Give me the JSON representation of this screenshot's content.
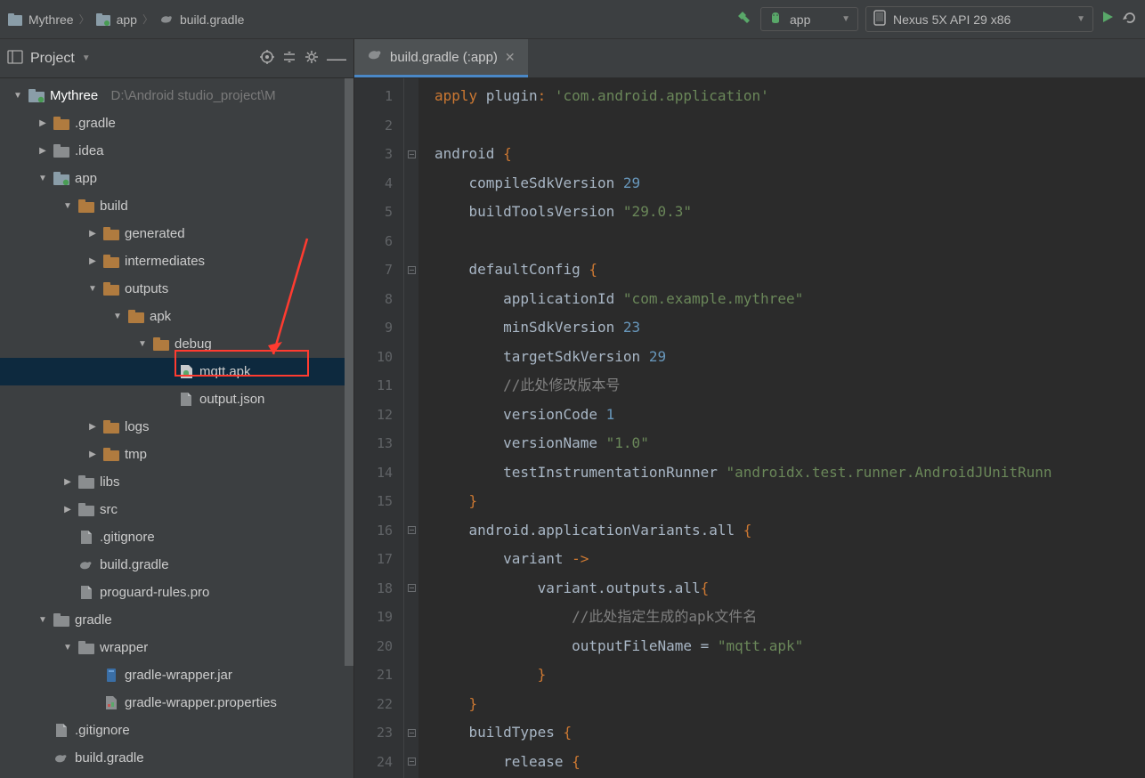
{
  "breadcrumb": {
    "items": [
      "Mythree",
      "app",
      "build.gradle"
    ]
  },
  "toolbar": {
    "run_config": "app",
    "device": "Nexus 5X API 29 x86"
  },
  "project_panel": {
    "title": "Project"
  },
  "tab": {
    "label": "build.gradle (:app)"
  },
  "tree": {
    "root": "Mythree",
    "root_path": "D:\\Android studio_project\\M",
    "nodes": [
      {
        "d": 0,
        "a": "down",
        "i": "module",
        "n": "Mythree",
        "extra": "D:\\Android studio_project\\M"
      },
      {
        "d": 1,
        "a": "right",
        "i": "folder",
        "n": ".gradle"
      },
      {
        "d": 1,
        "a": "right",
        "i": "folder-grey",
        "n": ".idea"
      },
      {
        "d": 1,
        "a": "down",
        "i": "module",
        "n": "app"
      },
      {
        "d": 2,
        "a": "down",
        "i": "folder",
        "n": "build"
      },
      {
        "d": 3,
        "a": "right",
        "i": "folder",
        "n": "generated"
      },
      {
        "d": 3,
        "a": "right",
        "i": "folder",
        "n": "intermediates"
      },
      {
        "d": 3,
        "a": "down",
        "i": "folder",
        "n": "outputs"
      },
      {
        "d": 4,
        "a": "down",
        "i": "folder",
        "n": "apk"
      },
      {
        "d": 5,
        "a": "down",
        "i": "folder",
        "n": "debug"
      },
      {
        "d": 6,
        "a": "",
        "i": "apk",
        "n": "mqtt.apk",
        "sel": true
      },
      {
        "d": 6,
        "a": "",
        "i": "file",
        "n": "output.json"
      },
      {
        "d": 3,
        "a": "right",
        "i": "folder",
        "n": "logs"
      },
      {
        "d": 3,
        "a": "right",
        "i": "folder",
        "n": "tmp"
      },
      {
        "d": 2,
        "a": "right",
        "i": "folder-grey",
        "n": "libs"
      },
      {
        "d": 2,
        "a": "right",
        "i": "folder-grey",
        "n": "src"
      },
      {
        "d": 2,
        "a": "",
        "i": "file",
        "n": ".gitignore"
      },
      {
        "d": 2,
        "a": "",
        "i": "gradle",
        "n": "build.gradle"
      },
      {
        "d": 2,
        "a": "",
        "i": "file",
        "n": "proguard-rules.pro"
      },
      {
        "d": 1,
        "a": "down",
        "i": "folder-grey",
        "n": "gradle"
      },
      {
        "d": 2,
        "a": "down",
        "i": "folder-grey",
        "n": "wrapper"
      },
      {
        "d": 3,
        "a": "",
        "i": "jar",
        "n": "gradle-wrapper.jar"
      },
      {
        "d": 3,
        "a": "",
        "i": "props",
        "n": "gradle-wrapper.properties"
      },
      {
        "d": 1,
        "a": "",
        "i": "file",
        "n": ".gitignore"
      },
      {
        "d": 1,
        "a": "",
        "i": "gradle",
        "n": "build.gradle"
      }
    ]
  },
  "code": {
    "lines": [
      {
        "n": 1,
        "f": "",
        "t": [
          [
            "kw",
            "apply"
          ],
          [
            "ident",
            " plugin"
          ],
          [
            "kw",
            ":"
          ],
          [
            "ident",
            " "
          ],
          [
            "str",
            "'com.android.application'"
          ]
        ]
      },
      {
        "n": 2,
        "f": "",
        "t": [
          [
            "",
            ""
          ]
        ]
      },
      {
        "n": 3,
        "f": "-",
        "t": [
          [
            "ident",
            "android "
          ],
          [
            "kw",
            "{"
          ]
        ]
      },
      {
        "n": 4,
        "f": "",
        "t": [
          [
            "ident",
            "    compileSdkVersion "
          ],
          [
            "num",
            "29"
          ]
        ]
      },
      {
        "n": 5,
        "f": "",
        "t": [
          [
            "ident",
            "    buildToolsVersion "
          ],
          [
            "str",
            "\"29.0.3\""
          ]
        ]
      },
      {
        "n": 6,
        "f": "",
        "t": [
          [
            "",
            ""
          ]
        ]
      },
      {
        "n": 7,
        "f": "-",
        "t": [
          [
            "ident",
            "    defaultConfig "
          ],
          [
            "kw",
            "{"
          ]
        ]
      },
      {
        "n": 8,
        "f": "",
        "t": [
          [
            "ident",
            "        applicationId "
          ],
          [
            "str",
            "\"com.example.mythree\""
          ]
        ]
      },
      {
        "n": 9,
        "f": "",
        "t": [
          [
            "ident",
            "        minSdkVersion "
          ],
          [
            "num",
            "23"
          ]
        ]
      },
      {
        "n": 10,
        "f": "",
        "t": [
          [
            "ident",
            "        targetSdkVersion "
          ],
          [
            "num",
            "29"
          ]
        ]
      },
      {
        "n": 11,
        "f": "",
        "t": [
          [
            "ident",
            "        "
          ],
          [
            "comment",
            "//此处修改版本号"
          ]
        ]
      },
      {
        "n": 12,
        "f": "",
        "t": [
          [
            "ident",
            "        versionCode "
          ],
          [
            "num",
            "1"
          ]
        ]
      },
      {
        "n": 13,
        "f": "",
        "t": [
          [
            "ident",
            "        versionName "
          ],
          [
            "str",
            "\"1.0\""
          ]
        ]
      },
      {
        "n": 14,
        "f": "",
        "t": [
          [
            "ident",
            "        testInstrumentationRunner "
          ],
          [
            "str",
            "\"androidx.test.runner.AndroidJUnitRunn"
          ]
        ]
      },
      {
        "n": 15,
        "f": "",
        "t": [
          [
            "ident",
            "    "
          ],
          [
            "kw",
            "}"
          ]
        ]
      },
      {
        "n": 16,
        "f": "-",
        "t": [
          [
            "ident",
            "    android.applicationVariants.all "
          ],
          [
            "kw",
            "{"
          ]
        ]
      },
      {
        "n": 17,
        "f": "",
        "t": [
          [
            "ident",
            "        variant "
          ],
          [
            "kw",
            "->"
          ]
        ]
      },
      {
        "n": 18,
        "f": "-",
        "t": [
          [
            "ident",
            "            variant.outputs.all"
          ],
          [
            "kw",
            "{"
          ]
        ]
      },
      {
        "n": 19,
        "f": "",
        "t": [
          [
            "ident",
            "                "
          ],
          [
            "comment",
            "//此处指定生成的apk文件名"
          ]
        ]
      },
      {
        "n": 20,
        "f": "",
        "t": [
          [
            "ident",
            "                outputFileName = "
          ],
          [
            "str",
            "\"mqtt.apk\""
          ]
        ]
      },
      {
        "n": 21,
        "f": "",
        "t": [
          [
            "ident",
            "            "
          ],
          [
            "kw",
            "}"
          ]
        ]
      },
      {
        "n": 22,
        "f": "",
        "t": [
          [
            "ident",
            "    "
          ],
          [
            "kw",
            "}"
          ]
        ]
      },
      {
        "n": 23,
        "f": "-",
        "t": [
          [
            "ident",
            "    buildTypes "
          ],
          [
            "kw",
            "{"
          ]
        ]
      },
      {
        "n": 24,
        "f": "-",
        "t": [
          [
            "ident",
            "        release "
          ],
          [
            "kw",
            "{"
          ]
        ]
      }
    ]
  }
}
